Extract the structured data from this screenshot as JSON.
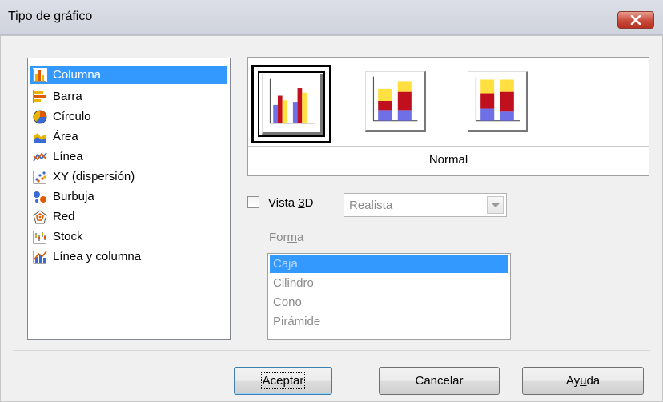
{
  "window": {
    "title": "Tipo de gráfico",
    "close_icon": "close-icon"
  },
  "chart_types": {
    "items": [
      {
        "label": "Columna",
        "icon": "column-chart-icon",
        "selected": true
      },
      {
        "label": "Barra",
        "icon": "bar-chart-icon",
        "selected": false
      },
      {
        "label": "Círculo",
        "icon": "pie-chart-icon",
        "selected": false
      },
      {
        "label": "Área",
        "icon": "area-chart-icon",
        "selected": false
      },
      {
        "label": "Línea",
        "icon": "line-chart-icon",
        "selected": false
      },
      {
        "label": "XY (dispersión)",
        "icon": "scatter-chart-icon",
        "selected": false
      },
      {
        "label": "Burbuja",
        "icon": "bubble-chart-icon",
        "selected": false
      },
      {
        "label": "Red",
        "icon": "net-chart-icon",
        "selected": false
      },
      {
        "label": "Stock",
        "icon": "stock-chart-icon",
        "selected": false
      },
      {
        "label": "Línea y columna",
        "icon": "line-column-chart-icon",
        "selected": false
      }
    ]
  },
  "variants": {
    "selected_name": "Normal",
    "items": [
      {
        "icon": "normal-column-variant-icon",
        "selected": true
      },
      {
        "icon": "stacked-column-variant-icon",
        "selected": false
      },
      {
        "icon": "percent-stacked-column-variant-icon",
        "selected": false
      }
    ]
  },
  "options": {
    "view3d_prefix": "Vista ",
    "view3d_underlined": "3",
    "view3d_suffix": "D",
    "view3d_checked": false,
    "scheme_value": "Realista",
    "shape_label_prefix": "For",
    "shape_label_underlined": "m",
    "shape_label_suffix": "a",
    "shapes": [
      "Caja",
      "Cilindro",
      "Cono",
      "Pirámide"
    ],
    "shape_selected": "Caja"
  },
  "buttons": {
    "ok": "Aceptar",
    "cancel": "Cancelar",
    "help_prefix": "Ay",
    "help_underlined": "u",
    "help_suffix": "da"
  },
  "colors": {
    "selection": "#3399ff",
    "series_blue": "#6f6fe6",
    "series_red": "#c0101e",
    "series_yellow": "#ffe040"
  }
}
